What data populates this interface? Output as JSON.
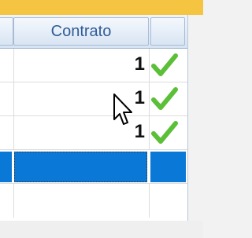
{
  "grid": {
    "header": {
      "label": "Contrato"
    },
    "rows": [
      {
        "value": "1",
        "status_icon": "check-icon"
      },
      {
        "value": "1",
        "status_icon": "check-icon"
      },
      {
        "value": "1",
        "status_icon": "check-icon"
      }
    ],
    "selected_row": {
      "value": ""
    }
  },
  "colors": {
    "header_text": "#2f5c98",
    "selection": "#0a78d6",
    "check": "#5bbf38"
  }
}
